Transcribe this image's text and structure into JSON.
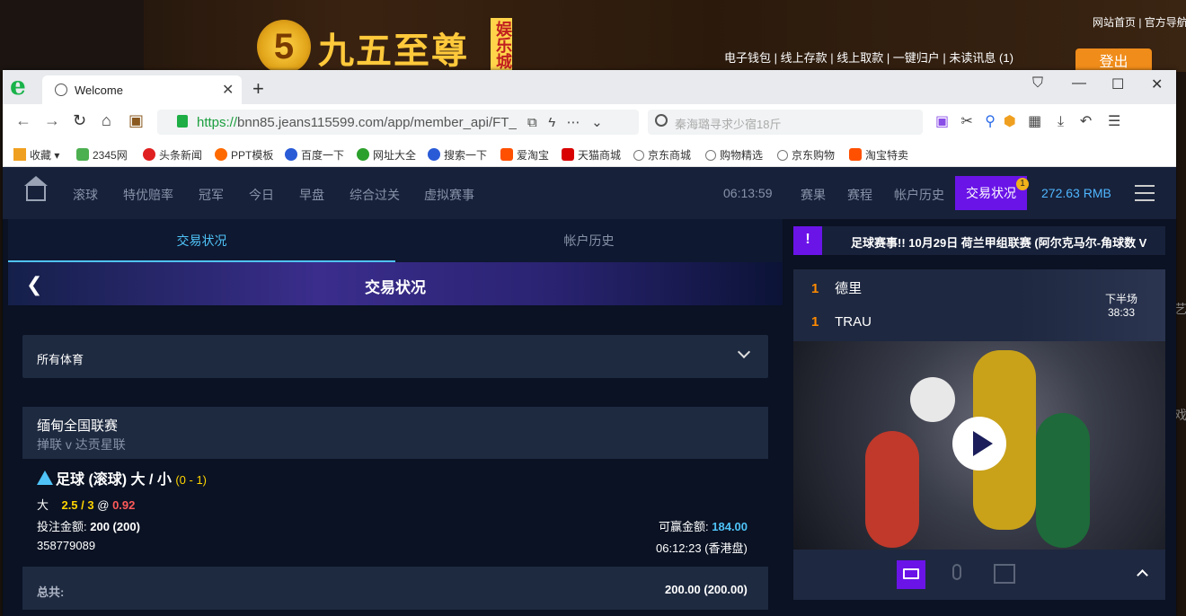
{
  "background_site": {
    "logo_text": "九五至尊",
    "logo_tag": "娱乐城",
    "top_links": "网站首页 | 官方导航",
    "nav_links": "电子钱包 | 线上存款 | 线上取款 | 一键归户 | 未读讯息 (1)",
    "login_label": "登出",
    "right_text_1": "艺",
    "right_text_2": "戏"
  },
  "browser": {
    "tab_title": "Welcome",
    "url_secure": "https://",
    "url_rest": "bnn85.jeans115599.com/app/member_api/FT_",
    "search_placeholder": "秦海璐寻求少宿18斤",
    "bookmarks": [
      {
        "label": "收藏",
        "color": "#f0a020"
      },
      {
        "label": "2345网",
        "color": "#4caf50"
      },
      {
        "label": "头条新闻",
        "color": "#e02020"
      },
      {
        "label": "PPT模板",
        "color": "#ff6a00"
      },
      {
        "label": "百度一下",
        "color": "#2a5bd7"
      },
      {
        "label": "网址大全",
        "color": "#2ca02c"
      },
      {
        "label": "搜索一下",
        "color": "#2a5bd7"
      },
      {
        "label": "爱淘宝",
        "color": "#ff5000"
      },
      {
        "label": "天猫商城",
        "color": "#d80000"
      },
      {
        "label": "京东商城",
        "color": "#777777"
      },
      {
        "label": "购物精选",
        "color": "#777777"
      },
      {
        "label": "京东购物",
        "color": "#777777"
      },
      {
        "label": "淘宝特卖",
        "color": "#ff5000"
      }
    ]
  },
  "topnav": {
    "items": [
      "滚球",
      "特优赔率",
      "冠军",
      "今日",
      "早盘",
      "综合过关",
      "虚拟赛事"
    ],
    "clock": "06:13:59",
    "right_items": [
      "赛果",
      "赛程",
      "帐户历史"
    ],
    "active": "交易状况",
    "badge": "1",
    "balance": "272.63 RMB"
  },
  "subtabs": [
    "交易状况",
    "帐户历史"
  ],
  "hero_title": "交易状况",
  "filter_label": "所有体育",
  "bet": {
    "league": "缅甸全国联赛",
    "match": "掸联   v   达贡星联",
    "type": "足球 (滚球) 大 / 小",
    "score": "(0 - 1)",
    "selection": "大",
    "line": "2.5 / 3",
    "at": "@",
    "odds": "0.92",
    "stake_label": "投注金额:",
    "stake_value": "200 (200)",
    "win_label": "可赢金额:",
    "win_value": "184.00",
    "id": "358779089",
    "time": "06:12:23 (香港盘)",
    "total_label": "总共:",
    "total_value": "200.00 (200.00)"
  },
  "ticker": "足球赛事!! 10月29日 荷兰甲组联赛 (阿尔克马尔-角球数 V",
  "score": {
    "home_score": "1",
    "home_team": "德里",
    "away_score": "1",
    "away_team": "TRAU",
    "period": "下半场",
    "time": "38:33"
  },
  "colors": {
    "accent": "#6a14e8",
    "highlight": "#4fc3f7",
    "bg": "#0a1223",
    "panel": "#1e2a40"
  }
}
